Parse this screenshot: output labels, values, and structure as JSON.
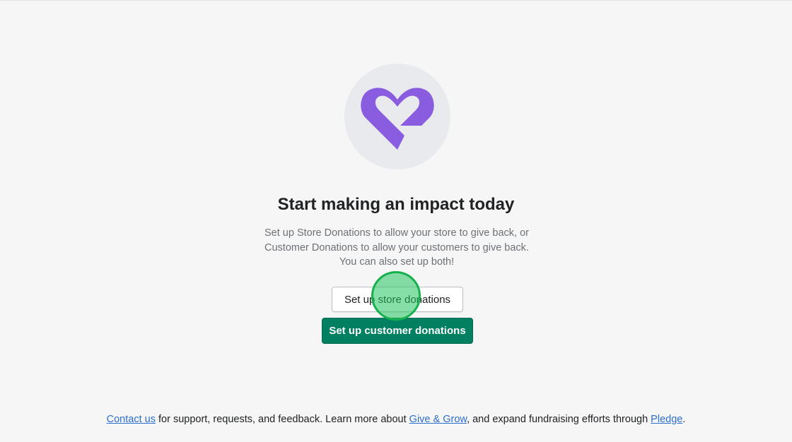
{
  "hero": {
    "icon": "heart-icon",
    "icon_color": "#8a5cdf",
    "circle_color": "#e9eaed"
  },
  "headline": "Start making an impact today",
  "description": {
    "line1": "Set up Store Donations to allow your store to give back, or",
    "line2": "Customer Donations to allow your customers to give back.",
    "line3": "You can also set up both!"
  },
  "buttons": {
    "store_label": "Set up store donations",
    "customer_label": "Set up customer donations",
    "primary_color": "#008060"
  },
  "footer": {
    "contact_link": "Contact us",
    "text1": " for support, requests, and feedback. Learn more about ",
    "give_grow_link": "Give & Grow",
    "text2": ", and expand fundraising efforts through ",
    "pledge_link": "Pledge",
    "text3": ".",
    "link_color": "#2c6ecb"
  }
}
